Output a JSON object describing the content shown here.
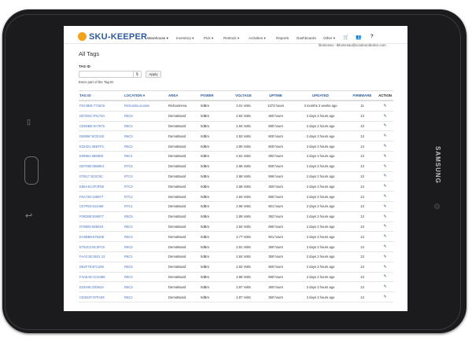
{
  "device": {
    "brand": "SAMSUNG",
    "recent_apps_glyph": "▯",
    "back_glyph": "↩"
  },
  "nav": {
    "logo_text": "SKU-KEEPER",
    "menus": [
      {
        "label": "Warehouse ▾"
      },
      {
        "label": "Inventory ▾"
      },
      {
        "label": "Pick ▾"
      },
      {
        "label": "Restock ▾"
      },
      {
        "label": "Activities ▾"
      },
      {
        "label": "Reports"
      },
      {
        "label": "Dashboards"
      },
      {
        "label": "Other ▾"
      }
    ],
    "cart_icon": "🛒",
    "users_icon": "👥",
    "help_icon": "?",
    "user_text": "blumenau - tblumenau@voodoorobotics.com"
  },
  "page": {
    "title": "All Tags",
    "tag_id_label": "TAG ID",
    "tag_id_value": "",
    "refresh_glyph": "↻",
    "apply_label": "Apply",
    "help_text": "Enter part of the Tag ID"
  },
  "table": {
    "headers": [
      "TAG ID",
      "LOCATION ▾",
      "AREA",
      "POWER",
      "VOLTAGE",
      "UPTIME",
      "UPDATED",
      "FIRMWARE",
      "ACTION"
    ],
    "edit_glyph": "✎",
    "rows": [
      [
        "FDC8EE:7745C5",
        "RichardsLocation",
        "RichardArea",
        "0dBm",
        "3.01 Volts",
        "1373 hours",
        "3 months 2 weeks ago",
        "11"
      ],
      [
        "DD7E5C:F8176A",
        "R6C5",
        "DemoBoard",
        "0dBm",
        "2.84 Volts",
        "360 hours",
        "2 days 2 hours ago",
        "13"
      ],
      [
        "CD05BE:9A7875",
        "R6C4",
        "DemoBoard",
        "0dBm",
        "2.84 Volts",
        "680 hours",
        "2 days 2 hours ago",
        "13"
      ],
      [
        "D6685F:8CE21E",
        "R6C3",
        "DemoBoard",
        "0dBm",
        "2.83 Volts",
        "600 hours",
        "2 days 2 hours ago",
        "13"
      ],
      [
        "E33421:2BEFFC",
        "R6C2",
        "DemoBoard",
        "0dBm",
        "2.80 Volts",
        "600 hours",
        "2 days 2 hours ago",
        "13"
      ],
      [
        "E08981:6885EE",
        "R6C1",
        "DemoBoard",
        "0dBm",
        "2.81 Volts",
        "392 hours",
        "2 days 2 hours ago",
        "13"
      ],
      [
        "DD7950:0B66E4",
        "R7C5",
        "DemoBoard",
        "0dBm",
        "2.86 Volts",
        "600 hours",
        "2 days 2 hours ago",
        "13"
      ],
      [
        "D7B17:1D3C5C",
        "R7C4",
        "DemoBoard",
        "0dBm",
        "2.88 Volts",
        "599 hours",
        "2 days 2 hours ago",
        "13"
      ],
      [
        "E5EA51:0F3F69",
        "R7C3",
        "DemoBoard",
        "0dBm",
        "2.88 Volts",
        "360 hours",
        "2 days 2 hours ago",
        "13"
      ],
      [
        "F5A72E:428877",
        "R7C2",
        "DemoBoard",
        "0dBm",
        "2.84 Volts",
        "680 hours",
        "2 days 2 hours ago",
        "13"
      ],
      [
        "C57FB4:814458",
        "R7C1",
        "DemoBoard",
        "0dBm",
        "2.96 Volts",
        "601 hours",
        "2 days 2 hours ago",
        "13"
      ],
      [
        "F00DB8:E66977",
        "R5C5",
        "DemoBoard",
        "0dBm",
        "2.89 Volts",
        "392 hours",
        "2 days 2 hours ago",
        "13"
      ],
      [
        "D76805:94B923",
        "R6C4",
        "DemoBoard",
        "0dBm",
        "2.84 Volts",
        "680 hours",
        "2 days 2 hours ago",
        "13"
      ],
      [
        "EA6BB6:67520E",
        "R6C3",
        "DemoBoard",
        "0dBm",
        "2.77 Volts",
        "601 hours",
        "2 days 2 hours ago",
        "13"
      ],
      [
        "E752C2:8C3FC8",
        "R6C2",
        "DemoBoard",
        "0dBm",
        "2.81 Volts",
        "360 hours",
        "2 days 2 hours ago",
        "13"
      ],
      [
        "FAAC1B:3631 13",
        "R6C1",
        "DemoBoard",
        "0dBm",
        "2.84 Volts",
        "360 hours",
        "2 days 2 hours ago",
        "13"
      ],
      [
        "D82F79:4FC269",
        "R5C5",
        "DemoBoard",
        "0dBm",
        "2.82 Volts",
        "660 hours",
        "2 days 2 hours ago",
        "13"
      ],
      [
        "F4AEAE:CC8488",
        "R6C4",
        "DemoBoard",
        "0dBm",
        "2.88 Volts",
        "680 hours",
        "2 days 2 hours ago",
        "13"
      ],
      [
        "E22046:22DB4A",
        "R6C3",
        "DemoBoard",
        "0dBm",
        "2.87 Volts",
        "360 hours",
        "2 days 2 hours ago",
        "13"
      ],
      [
        "CD4E2F:97FA08",
        "R5C2",
        "DemoBoard",
        "0dBm",
        "2.87 Volts",
        "360 hours",
        "2 days 2 hours ago",
        "13"
      ]
    ]
  }
}
